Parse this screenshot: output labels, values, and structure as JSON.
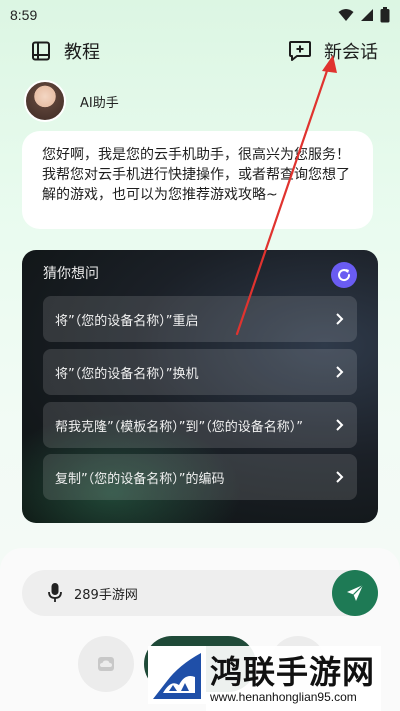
{
  "status_bar": {
    "time": "8:59"
  },
  "header": {
    "tutorial_label": "教程",
    "new_chat_label": "新会话"
  },
  "assistant": {
    "name": "AI助手",
    "greeting": "您好啊，我是您的云手机助手，很高兴为您服务！我帮您对云手机进行快捷操作，或者帮查询您想了解的游戏，也可以为您推荐游戏攻略~"
  },
  "suggestions_card": {
    "title": "猜你想问",
    "items": [
      {
        "label": "将”（您的设备名称）”重启"
      },
      {
        "label": "将”（您的设备名称）”换机"
      },
      {
        "label": "帮我克隆”（模板名称）”到”（您的设备名称）”"
      },
      {
        "label": "复制”（您的设备名称）”的编码"
      }
    ],
    "accent": "#6a5cf2"
  },
  "input": {
    "value": "289手游网"
  },
  "colors": {
    "send_button": "#1e7a55",
    "annotation_arrow": "#e0332f"
  },
  "watermark": {
    "title": "鸿联手游网",
    "url": "www.henanhonglian95.com"
  }
}
